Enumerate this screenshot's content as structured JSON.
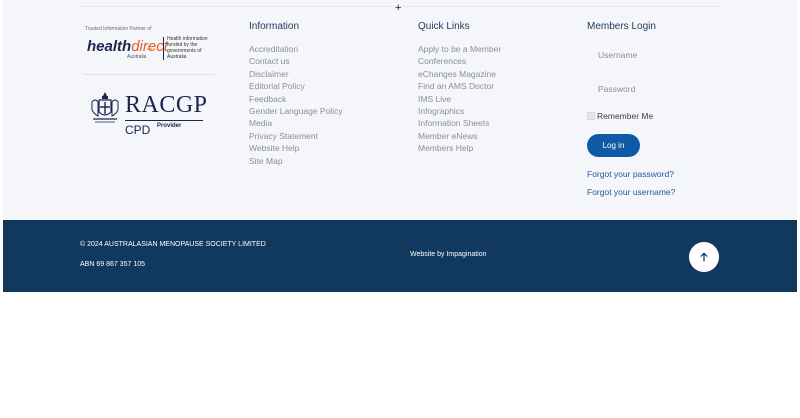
{
  "partners": {
    "healthdirect": {
      "tagline": "Trusted Information Partner of",
      "word_main": "health",
      "word_accent": "direct",
      "sub": "Australia",
      "note": "Health information funded by the governments of Australia"
    },
    "racgp": {
      "word": "RACGP",
      "cpd": "CPD",
      "provider": "Provider"
    }
  },
  "information": {
    "title": "Information",
    "links": [
      "Accreditation",
      "Contact us",
      "Disclaimer",
      "Editorial Policy",
      "Feedback",
      "Gender Language Policy",
      "Media",
      "Privacy Statement",
      "Website Help",
      "Site Map"
    ]
  },
  "quick_links": {
    "title": "Quick Links",
    "links": [
      "Apply to be a Member",
      "Conferences",
      "eChanges Magazine",
      "Find an AMS Doctor",
      "IMS Live",
      "Infographics",
      "Information Sheets",
      "Member eNews",
      "Members Help"
    ]
  },
  "login": {
    "title": "Members Login",
    "username_placeholder": "Username",
    "password_placeholder": "Password",
    "remember_label": "Remember Me",
    "button_label": "Log in",
    "forgot_password": "Forgot your password?",
    "forgot_username": "Forgot your username?"
  },
  "footer": {
    "copyright": "© 2024 AUSTRALASIAN MENOPAUSE SOCIETY LIMITED",
    "abn": "ABN 69 867 357 105",
    "credit": "Website by Impagination",
    "plus_glyph": "+"
  },
  "colors": {
    "footer_bg": "#11385f",
    "top_bg": "#f4f6f9",
    "button": "#0e5aa7",
    "link_accent": "#1d5a9c"
  },
  "icons": {
    "back_to_top": "arrow-up-icon",
    "crest": "coat-of-arms-icon"
  }
}
